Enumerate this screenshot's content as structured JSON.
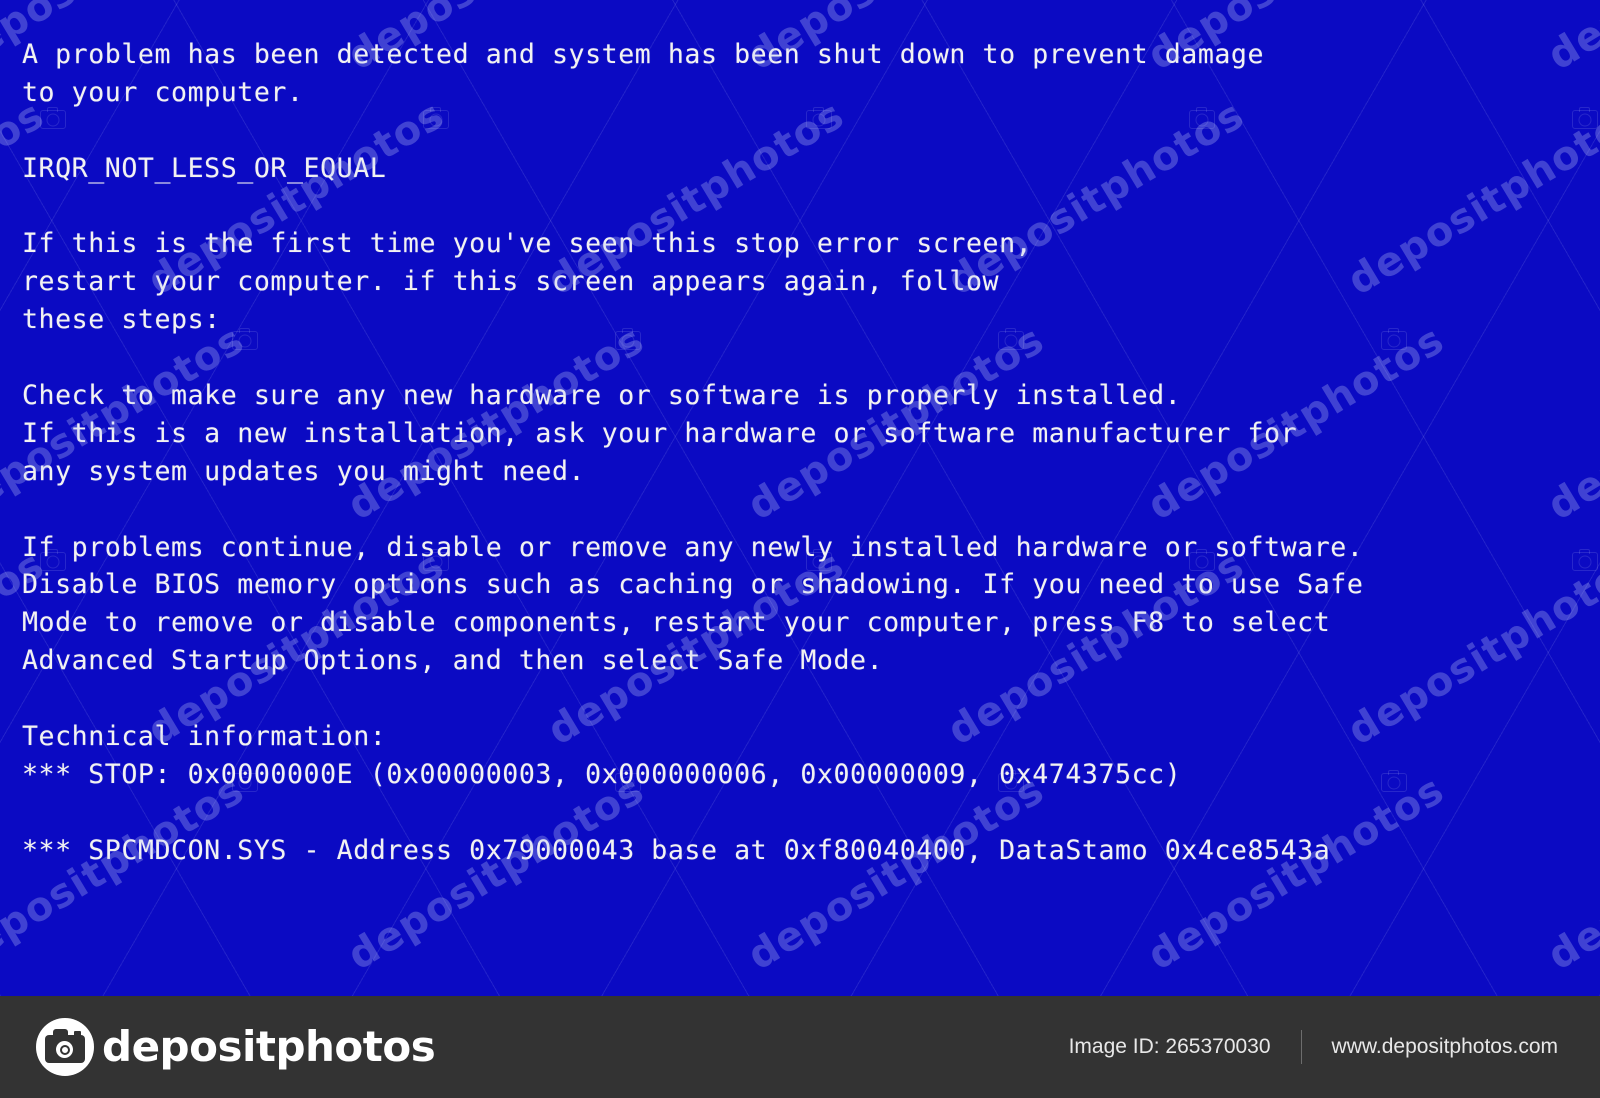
{
  "screen": {
    "type": "windows-stop-error-blue-screen",
    "background_color": "#0b0ac3",
    "text_color": "#f2f2f2",
    "lines": [
      "A problem has been detected and system has been shut down to prevent damage",
      "to your computer.",
      "",
      "IRQR_NOT_LESS_OR_EQUAL",
      "",
      "If this is the first time you've seen this stop error screen,",
      "restart your computer. if this screen appears again, follow",
      "these steps:",
      "",
      "Check to make sure any new hardware or software is properly installed.",
      "If this is a new installation, ask your hardware or software manufacturer for",
      "any system updates you might need.",
      "",
      "If problems continue, disable or remove any newly installed hardware or software.",
      "Disable BIOS memory options such as caching or shadowing. If you need to use Safe",
      "Mode to remove or disable components, restart your computer, press F8 to select",
      "Advanced Startup Options, and then select Safe Mode.",
      "",
      "Technical information:",
      "*** STOP: 0x0000000E (0x00000003, 0x000000006, 0x00000009, 0x474375cc)",
      "",
      "*** SPCMDCON.SYS - Address 0x79000043 base at 0xf80040400, DataStamo 0x4ce8543a"
    ],
    "error_code": "IRQR_NOT_LESS_OR_EQUAL",
    "stop_code": "0x0000000E",
    "stop_parameters": [
      "0x00000003",
      "0x000000006",
      "0x00000009",
      "0x474375cc"
    ],
    "driver": "SPCMDCON.SYS",
    "driver_address": "0x79000043",
    "driver_base": "0xf80040400",
    "driver_datestamp": "0x4ce8543a"
  },
  "watermark": {
    "text": "depositphotos",
    "icon": "camera-icon",
    "color": "rgba(190,200,250,0.30)"
  },
  "footer": {
    "background_color": "#333333",
    "logo_icon": "camera-circle-icon",
    "brand": "depositphotos",
    "image_id_label": "Image ID: 265370030",
    "website": "www.depositphotos.com"
  }
}
